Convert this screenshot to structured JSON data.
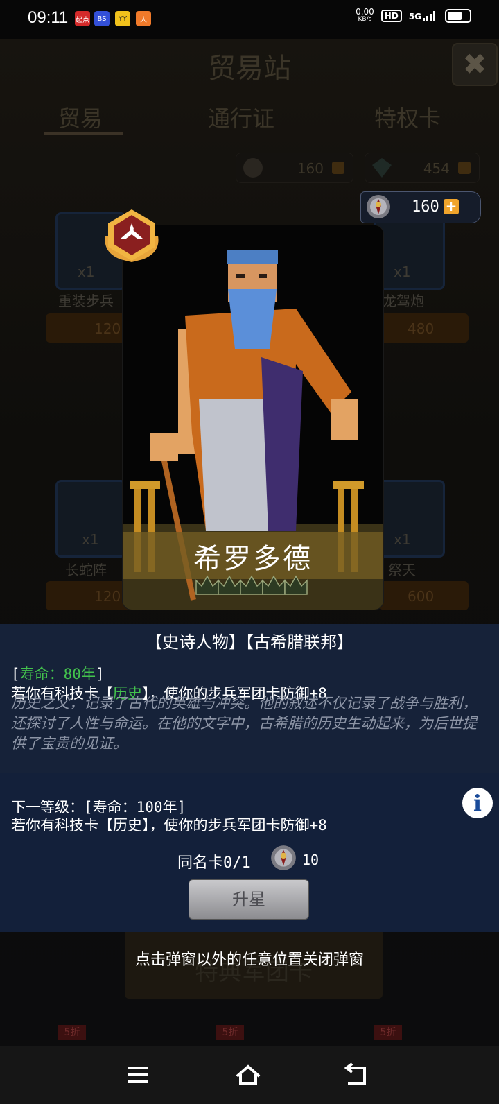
{
  "status_bar": {
    "time": "09:11",
    "notification_icons": [
      "起点",
      "BS",
      "YY",
      "人"
    ],
    "net_speed": "0.00",
    "net_speed_unit": "KB/s",
    "hd": "HD",
    "network": "5G"
  },
  "background": {
    "title": "贸易站",
    "close_glyph": "✖",
    "tabs": [
      {
        "label": "贸易"
      },
      {
        "label": "通行证"
      },
      {
        "label": "特权卡"
      }
    ],
    "resources": [
      {
        "value": "160"
      },
      {
        "value": "454"
      }
    ],
    "cards": [
      {
        "label": "重装步兵",
        "count": "x1",
        "price": "120"
      },
      {
        "label": "龙驾炮",
        "count": "x1",
        "price": "480"
      },
      {
        "label": "长蛇阵",
        "count": "x1",
        "price": "120"
      },
      {
        "label": "祭天",
        "count": "x1",
        "price": "600"
      }
    ],
    "banner_text": "特典军团卡",
    "sale_badge": "5折"
  },
  "resource_chip": {
    "value": "160",
    "plus": "+"
  },
  "card": {
    "name": "希罗多德",
    "stars_total": 5,
    "stars_filled": 0
  },
  "info": {
    "tags": "【史诗人物】【古希腊联邦】",
    "lifespan_open": "[",
    "lifespan": "寿命：80年",
    "lifespan_close": "]",
    "effect_prefix": "若你有科技卡【",
    "effect_tech": "历史",
    "effect_suffix": "】，使你的步兵军团卡防御+8",
    "description": "历史之父，记录了古代的英雄与冲突。他的叙述不仅记录了战争与胜利，还探讨了人性与命运。在他的文字中，古希腊的历史生动起来，为后世提供了宝贵的见证。",
    "next_level_label": "下一等级：[寿命：100年]",
    "next_level_effect": "若你有科技卡【历史】，使你的步兵军团卡防御+8",
    "info_glyph": "i",
    "duplicate_label": "同名卡0/1",
    "duplicate_cost": "10",
    "upgrade_button": "升星",
    "close_hint": "点击弹窗以外的任意位置关闭弹窗"
  },
  "colors": {
    "accent_orange": "#f0a42b",
    "panel_blue": "#162239",
    "lifespan_green": "#43c24d"
  }
}
